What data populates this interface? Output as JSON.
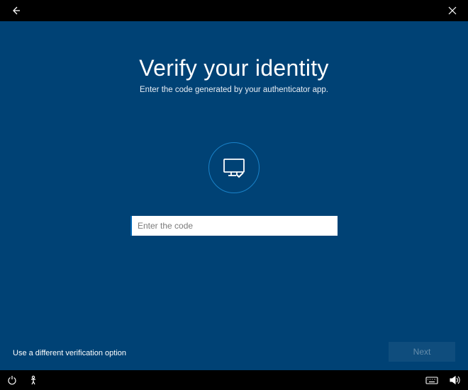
{
  "header": {
    "title": "Verify your identity",
    "subtitle": "Enter the code generated by your authenticator app."
  },
  "input": {
    "placeholder": "Enter the code",
    "value": ""
  },
  "links": {
    "alt_verification": "Use a different verification option"
  },
  "buttons": {
    "next": "Next"
  }
}
